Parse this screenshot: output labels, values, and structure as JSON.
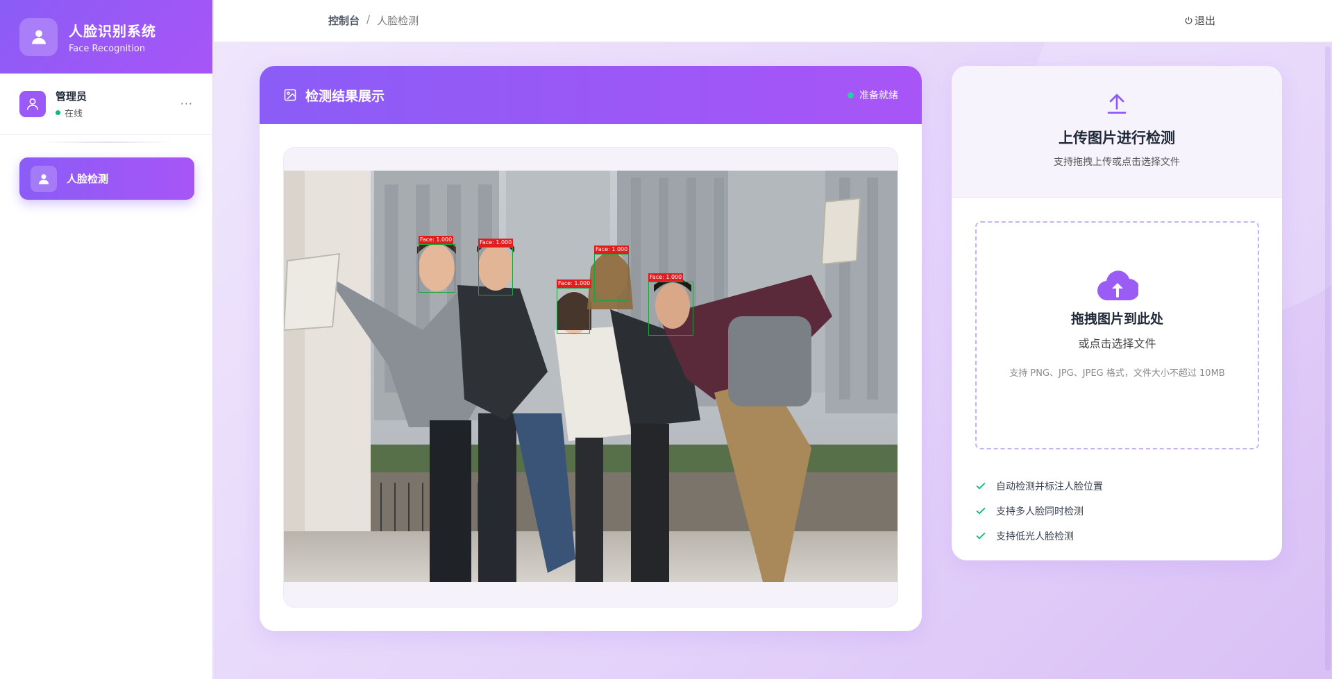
{
  "brand": {
    "title": "人脸识别系统",
    "subtitle": "Face Recognition"
  },
  "user": {
    "name": "管理员",
    "status": "在线",
    "more": "···"
  },
  "nav": {
    "items": [
      {
        "label": "人脸检测",
        "active": true
      }
    ]
  },
  "breadcrumb": {
    "root": "控制台",
    "separator": "/",
    "current": "人脸检测"
  },
  "topbar": {
    "logout": "退出"
  },
  "result": {
    "title": "检测结果展示",
    "status": "准备就绪",
    "faces": [
      {
        "label": "Face: 1.000"
      },
      {
        "label": "Face: 1.000"
      },
      {
        "label": "Face: 1.000"
      },
      {
        "label": "Face: 1.000"
      },
      {
        "label": "Face: 1.000"
      }
    ]
  },
  "upload": {
    "title": "上传图片进行检测",
    "subtitle": "支持拖拽上传或点击选择文件",
    "drop_title": "拖拽图片到此处",
    "drop_sub": "或点击选择文件",
    "drop_hint": "支持 PNG、JPG、JPEG 格式，文件大小不超过 10MB",
    "features": [
      "自动检测并标注人脸位置",
      "支持多人脸同时检测",
      "支持低光人脸检测"
    ]
  },
  "colors": {
    "accent": "#8b5cf6",
    "accent2": "#a855f7",
    "success": "#10b981",
    "faceBox": "#1aa53a",
    "faceLabel": "#e21d1d"
  },
  "icons": {
    "brand": "user-icon",
    "avatar": "user-outline-icon",
    "nav": "user-icon",
    "result": "image-icon",
    "upload": "arrow-up-icon",
    "drop": "cloud-upload-icon",
    "check": "check-icon",
    "logout": "power-icon"
  }
}
